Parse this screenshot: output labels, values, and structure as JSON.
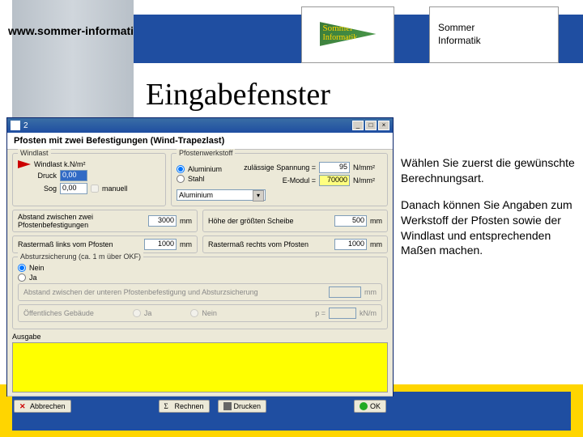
{
  "header": {
    "url": "www.sommer-informatik.de",
    "logo_flag_line1": "Sommer",
    "logo_flag_line2": "Informatik",
    "logo_text": "Sommer\nInformatik"
  },
  "title": "Eingabefenster",
  "sidetext": {
    "p1": "Wählen Sie zuerst die gewünschte Berechnungsart.",
    "p2": "Danach können Sie Angaben zum Werkstoff der Pfosten sowie der Windlast und entsprechenden Maßen machen."
  },
  "dialog": {
    "window_title": "2",
    "heading": "Pfosten mit zwei Befestigungen (Wind-Trapezlast)",
    "windlast": {
      "group_label": "Windlast",
      "label": "Windlast k.N/m²",
      "druck_label": "Druck",
      "druck_value": "0,00",
      "sog_label": "Sog",
      "sog_value": "0,00",
      "manuell_label": "manuell"
    },
    "werkstoff": {
      "group_label": "Pfostenwerkstoff",
      "opt_aluminium": "Aluminium",
      "opt_stahl": "Stahl",
      "spannung_label": "zulässige Spannung =",
      "spannung_value": "95",
      "spannung_unit": "N/mm²",
      "emodul_label": "E-Modul =",
      "emodul_value": "70000",
      "emodul_unit": "N/mm²",
      "combo_value": "Aluminium"
    },
    "rows": {
      "abstand_befest_label": "Abstand zwischen zwei Pfostenbefestigungen",
      "abstand_befest_value": "3000",
      "mm": "mm",
      "hoehe_scheibe_label": "Höhe der größten Scheibe",
      "hoehe_scheibe_value": "500",
      "raster_links_label": "Rastermaß links vom Pfosten",
      "raster_links_value": "1000",
      "raster_rechts_label": "Rastermaß rechts vom Pfosten",
      "raster_rechts_value": "1000"
    },
    "absturz": {
      "group_label": "Absturzsicherung (ca. 1 m über OKF)",
      "opt_nein": "Nein",
      "opt_ja": "Ja",
      "abstand_unten_label": "Abstand zwischen der unteren Pfostenbefestigung und Absturzsicherung",
      "abstand_unten_unit": "mm",
      "gebaeude_label": "Öffentliches Gebäude",
      "p_label": "p =",
      "p_unit": "kN/m"
    },
    "ausgabe_label": "Ausgabe",
    "buttons": {
      "abbrechen": "Abbrechen",
      "rechnen": "Rechnen",
      "drucken": "Drucken",
      "ok": "OK"
    }
  }
}
